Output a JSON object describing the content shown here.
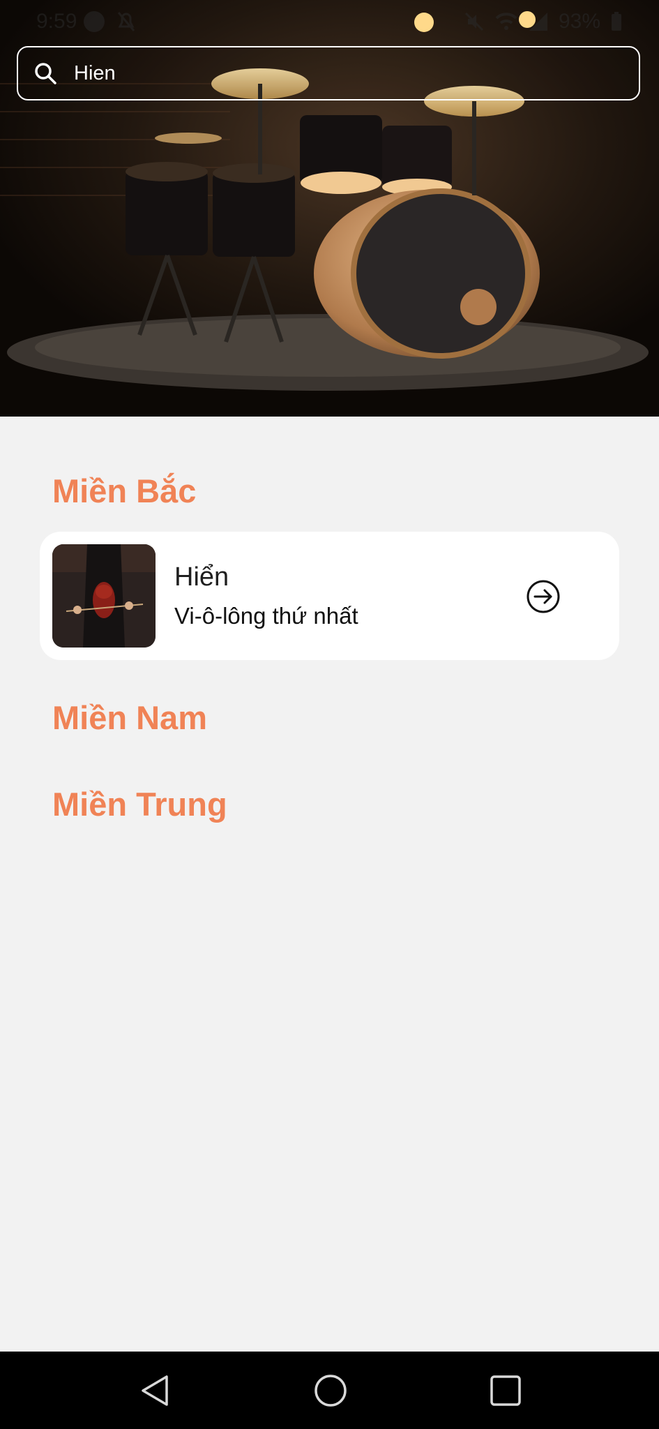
{
  "status_bar": {
    "time": "9:59",
    "battery": "93%"
  },
  "search": {
    "value": "Hien",
    "placeholder": ""
  },
  "sections": {
    "north": {
      "title": "Miền Bắc"
    },
    "south": {
      "title": "Miền Nam"
    },
    "central": {
      "title": "Miền Trung"
    }
  },
  "results": [
    {
      "title": "Hiển",
      "subtitle": "Vi-ô-lông thứ nhất",
      "thumbnail": "violin-player-image",
      "action_icon": "arrow-right-circle-icon"
    }
  ],
  "nav_bar": {
    "back_icon": "back-triangle-icon",
    "home_icon": "home-circle-icon",
    "recents_icon": "recents-square-icon"
  },
  "colors": {
    "accent": "#f08356",
    "background": "#f2f2f2",
    "card": "#ffffff",
    "nav": "#000000"
  }
}
